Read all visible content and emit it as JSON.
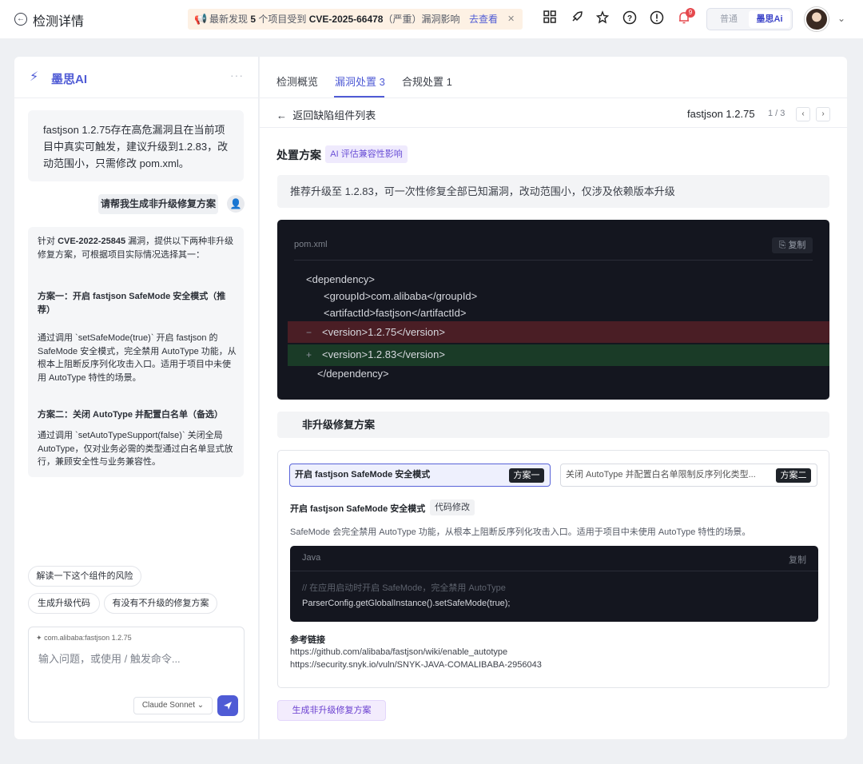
{
  "header": {
    "title": "检测详情",
    "notice_pre": "最新发现",
    "notice_count": "5",
    "notice_mid": "个项目受到",
    "notice_cve": "CVE-2025-66478",
    "notice_post": "（严重）漏洞影响",
    "notice_link": "去查看",
    "bell_count": "9",
    "mode_normal": "普通",
    "mode_ai": "墨思Ai"
  },
  "left": {
    "title": "墨思AI",
    "msg1": "fastjson 1.2.75存在高危漏洞且在当前项目中真实可触发，建议升级到1.2.83，改动范围小，只需修改 pom.xml。",
    "user_msg": "请帮我生成非升级修复方案",
    "reply_pre": "针对",
    "reply_cve": "CVE-2022-25845",
    "reply_post": "漏洞，提供以下两种非升级修复方案，可根据项目实际情况选择其一：",
    "plan1_title": "方案一：开启 fastjson SafeMode 安全模式（推荐）",
    "plan1_desc": "通过调用 `setSafeMode(true)` 开启 fastjson 的 SafeMode 安全模式，完全禁用 AutoType 功能，从根本上阻断反序列化攻击入口。适用于项目中未使用 AutoType 特性的场景。",
    "plan2_title": "方案二：关闭 AutoType 并配置白名单（备选）",
    "plan2_desc": "通过调用 `setAutoTypeSupport(false)` 关闭全局 AutoType，仅对业务必需的类型通过白名单显式放行，兼顾安全性与业务兼容性。",
    "chips": [
      "解读一下这个组件的风险",
      "生成升级代码",
      "有没有不升级的修复方案"
    ],
    "context": "com.alibaba:fastjson 1.2.75",
    "placeholder": "输入问题，或使用 / 触发命令...",
    "model": "Claude Sonnet"
  },
  "right": {
    "tabs": [
      "检测概览",
      "漏洞处置 3",
      "合规处置 1"
    ],
    "back": "返回缺陷组件列表",
    "component": "fastjson 1.2.75",
    "pager": "1 / 3",
    "plan_title": "处置方案",
    "ai_eval": "AI 评估兼容性影响",
    "recommend": "推荐升级至 1.2.83，可一次性修复全部已知漏洞，改动范围小，仅涉及依赖版本升级",
    "code1": {
      "file": "pom.xml",
      "copy": "复制",
      "lines": [
        "<dependency>",
        "<groupId>com.alibaba</groupId>",
        "<artifactId>fastjson</artifactId>",
        "<version>1.2.75</version>",
        "<version>1.2.83</version>",
        "</dependency>"
      ]
    },
    "nonupgrade_title": "非升级修复方案",
    "opt1": "开启 fastjson SafeMode 安全模式",
    "opt1_tag": "方案一",
    "opt2": "关闭 AutoType 并配置白名单限制反序列化类型...",
    "opt2_tag": "方案二",
    "sub_title": "开启 fastjson SafeMode 安全模式",
    "sub_tag": "代码修改",
    "sub_desc": "SafeMode 会完全禁用 AutoType 功能，从根本上阻断反序列化攻击入口。适用于项目中未使用 AutoType 特性的场景。",
    "code2": {
      "lang": "Java",
      "copy": "复制",
      "comment": "// 在应用启动时开启 SafeMode，完全禁用 AutoType",
      "line": "ParserConfig.getGlobalInstance().setSafeMode(true);"
    },
    "ref_title": "参考链接",
    "refs": [
      "https://github.com/alibaba/fastjson/wiki/enable_autotype",
      "https://security.snyk.io/vuln/SNYK-JAVA-COMALIBABA-2956043"
    ],
    "gen_btn": "生成非升级修复方案"
  }
}
